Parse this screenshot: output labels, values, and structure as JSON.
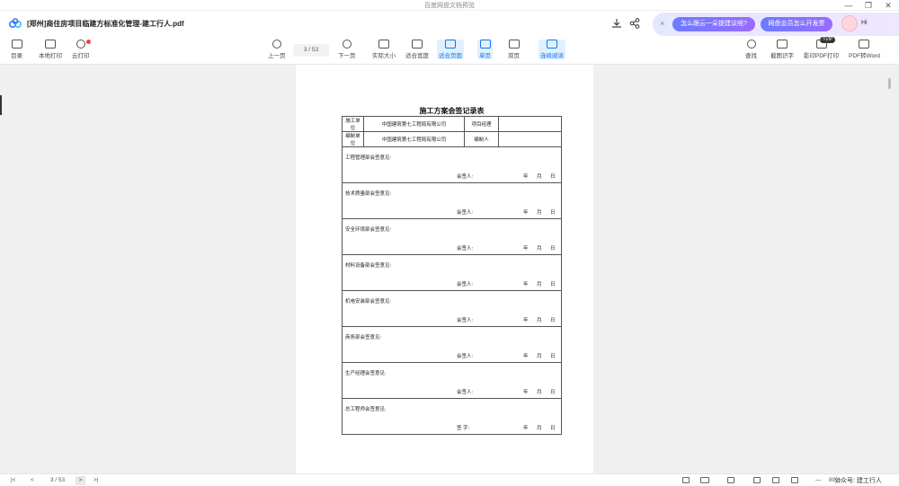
{
  "window": {
    "app_title": "百度网盘文档预览",
    "minimize": "—",
    "restore": "❐",
    "close": "✕"
  },
  "header": {
    "file_title": "[郑州]商住房项目临建方标准化管理-建工行人.pdf",
    "promo": {
      "close": "×",
      "q1": "怎么跟云一朵提建议呢?",
      "q2": "网盘会员怎么开发票",
      "hi": "Hi"
    }
  },
  "toolbar": {
    "catalog": "目录",
    "local_print": "本地打印",
    "cloud_print": "云打印",
    "prev_page": "上一页",
    "page_indicator": "3 / 53",
    "next_page": "下一页",
    "actual_size": "实际大小",
    "fit_width": "适合宽度",
    "fit_page": "适合页面",
    "single_page": "单页",
    "double_page": "双页",
    "continuous": "连续阅读",
    "find": "查找",
    "screenshot_ocr": "截图识字",
    "scan_pdf": "影印PDF打印",
    "pdf_to_word": "PDF转Word",
    "new_badge": "SVIP"
  },
  "document": {
    "form_title": "施工方案会签记录表",
    "row1": {
      "label1": "施工单位",
      "value1": "中国建筑第七工程局有限公司",
      "label2": "项目经理",
      "value2": ""
    },
    "row2": {
      "label1": "编制单位",
      "value1": "中国建筑第七工程局有限公司",
      "label2": "编制人",
      "value2": ""
    },
    "sections": [
      {
        "label": "工程管理部会签意见:",
        "sign": "会签人:",
        "date": "年 月 日"
      },
      {
        "label": "技术质量部会签意见:",
        "sign": "会签人:",
        "date": "年 月 日"
      },
      {
        "label": "安全环境部会签意见:",
        "sign": "会签人:",
        "date": "年 月 日"
      },
      {
        "label": "材料设备部会签意见:",
        "sign": "会签人:",
        "date": "年 月 日"
      },
      {
        "label": "机电安装部会签意见:",
        "sign": "会签人:",
        "date": "年 月 日"
      },
      {
        "label": "商务部会签意见:",
        "sign": "会签人:",
        "date": "年 月 日"
      },
      {
        "label": "生产经理会签意见:",
        "sign": "会签人:",
        "date": "年 月 日"
      },
      {
        "label": "总工程师会签意见:",
        "sign": "签  字:",
        "date": "年 月 日"
      }
    ]
  },
  "statusbar": {
    "first": "|<",
    "prev": "<",
    "page": "3 / 53",
    "next": ">",
    "last": ">|",
    "zoom_out": "—",
    "zoom": "80%",
    "watermark": "公众号: 建工行人"
  },
  "colors": {
    "accent": "#1a73e8",
    "active_bg": "#dff0ff",
    "promo_pill": "#7b72ff"
  }
}
